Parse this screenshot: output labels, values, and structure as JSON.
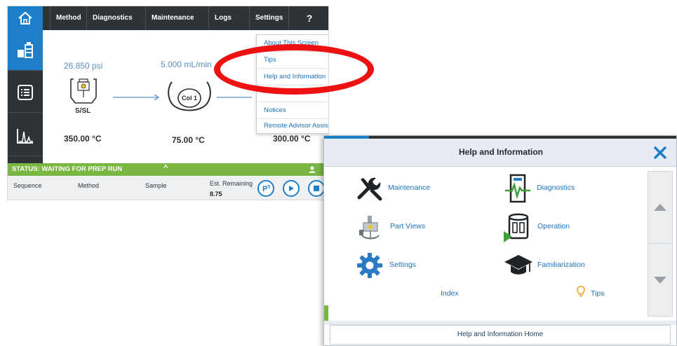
{
  "nav": {
    "method": "Method",
    "diagnostics": "Diagnostics",
    "maintenance": "Maintenance",
    "logs": "Logs",
    "settings": "Settings",
    "help": "?"
  },
  "flow": {
    "inlet_pressure": "26.850 psi",
    "column_flow": "5.000 mL/min",
    "inlet_name": "S/SL",
    "column_name": "Col 1",
    "inlet_temp": "350.00 °C",
    "oven_temp": "75.00 °C",
    "detector_temp": "300.00 °C"
  },
  "settings_menu": {
    "items": [
      "About This Screen",
      "Tips",
      "Help and Information",
      "Notices",
      "Remote Advisor Assist"
    ]
  },
  "status": {
    "text": "STATUS: WAITING FOR PREP RUN",
    "columns": {
      "sequence": "Sequence",
      "method": "Method",
      "sample": "Sample",
      "est_remaining": "Est. Remaining"
    },
    "est_remaining_value": "8.75"
  },
  "help_dialog": {
    "title": "Help and Information",
    "links": {
      "maintenance": "Maintenance",
      "diagnostics": "Diagnostics",
      "part_views": "Part Views",
      "operation": "Operation",
      "settings": "Settings",
      "familiarization": "Familiarization",
      "index": "Index",
      "tips": "Tips"
    },
    "home_button": "Help and Information Home"
  },
  "colors": {
    "accent_blue": "#1e7fc9",
    "nav_dark": "#2e3338",
    "status_green": "#7ab642",
    "highlight_red": "#ee1111"
  }
}
